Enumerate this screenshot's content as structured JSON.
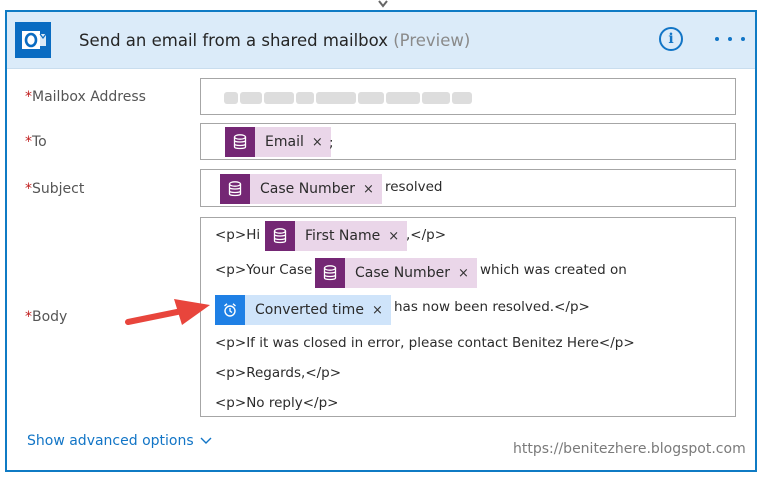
{
  "header": {
    "title": "Send an email from a shared mailbox",
    "preview": "(Preview)",
    "info_icon": "info-icon",
    "more_icon": "ellipsis-icon",
    "app_icon": "outlook-icon"
  },
  "fields": {
    "mailbox": {
      "required": "*",
      "label": "Mailbox Address",
      "value_obscured": true
    },
    "to": {
      "required": "*",
      "label": "To",
      "token": "Email",
      "suffix": ";"
    },
    "subject": {
      "required": "*",
      "label": "Subject",
      "token": "Case Number",
      "suffix": "resolved"
    },
    "body": {
      "required": "*",
      "label": "Body",
      "line1_prefix": "<p>Hi",
      "line1_token": "First Name",
      "line1_suffix": ",</p>",
      "line2_prefix": "<p>Your Case",
      "line2_token": "Case Number",
      "line2_suffix": "which was created on",
      "line3_token": "Converted time",
      "line3_suffix": "has now been resolved.</p>",
      "line4": "<p>If it was closed in error, please contact Benitez Here</p>",
      "line5": "<p>Regards,</p>",
      "line6": "<p>No reply</p>"
    }
  },
  "token_close": "×",
  "advanced_options": "Show advanced options",
  "watermark": "https://benitezhere.blogspot.com",
  "colors": {
    "card_border": "#0f7bc4",
    "header_bg": "#dbebf9",
    "dynamic_token": "#742774",
    "dynamic_token_bg": "#ead6e9",
    "expression_token": "#1f80e5",
    "expression_token_bg": "#cfe4fa",
    "annotation_arrow": "#e8453c"
  }
}
